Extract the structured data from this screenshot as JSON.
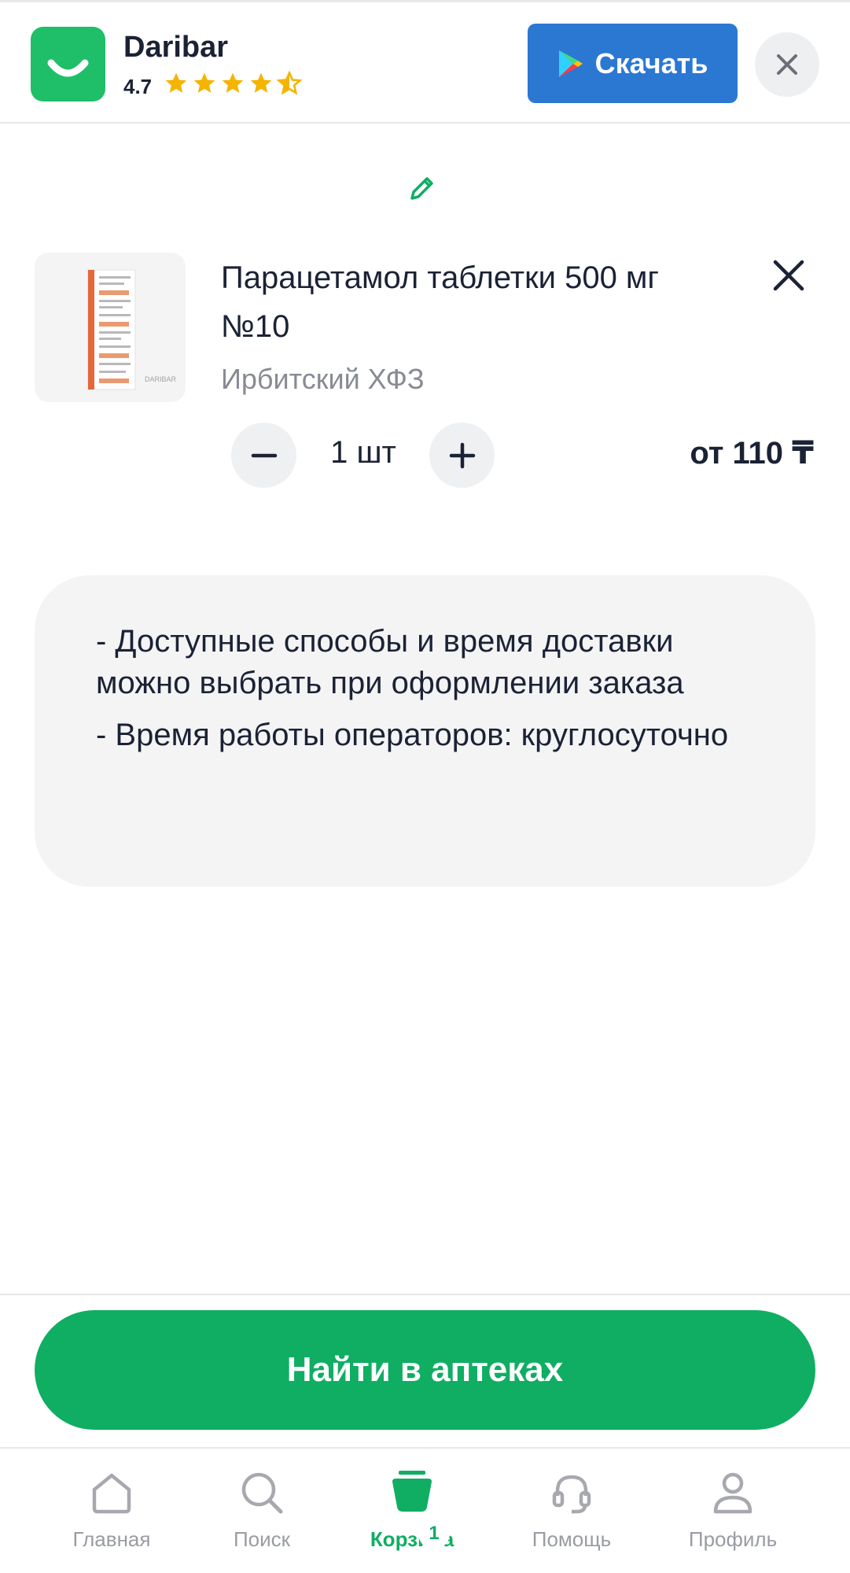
{
  "banner": {
    "app_name": "Daribar",
    "rating": "4.7",
    "stars_filled": 4.5,
    "download_label": "Скачать",
    "accent": "#2b78d3",
    "icon": "daribar-smile-icon"
  },
  "cart": {
    "edit_icon": "pencil-icon",
    "item": {
      "name": "Парацетамол таблетки 500 мг №10",
      "manufacturer": "Ирбитский ХФЗ",
      "quantity": "1 шт",
      "price": "от 110 ₸",
      "image_watermark": "DARIBAR"
    },
    "info_lines": [
      "- Доступные способы и время доставки можно выбрать при оформлении заказа",
      "- Время работы операторов: круглосуточно"
    ],
    "find_button": "Найти в аптеках",
    "brand_color": "#0fae63"
  },
  "nav": {
    "items": [
      {
        "label": "Главная",
        "icon": "home-icon",
        "active": false
      },
      {
        "label": "Поиск",
        "icon": "search-icon",
        "active": false
      },
      {
        "label": "Корзина",
        "icon": "cart-icon",
        "active": true,
        "badge": "1"
      },
      {
        "label": "Помощь",
        "icon": "headset-icon",
        "active": false
      },
      {
        "label": "Профиль",
        "icon": "profile-icon",
        "active": false
      }
    ]
  }
}
